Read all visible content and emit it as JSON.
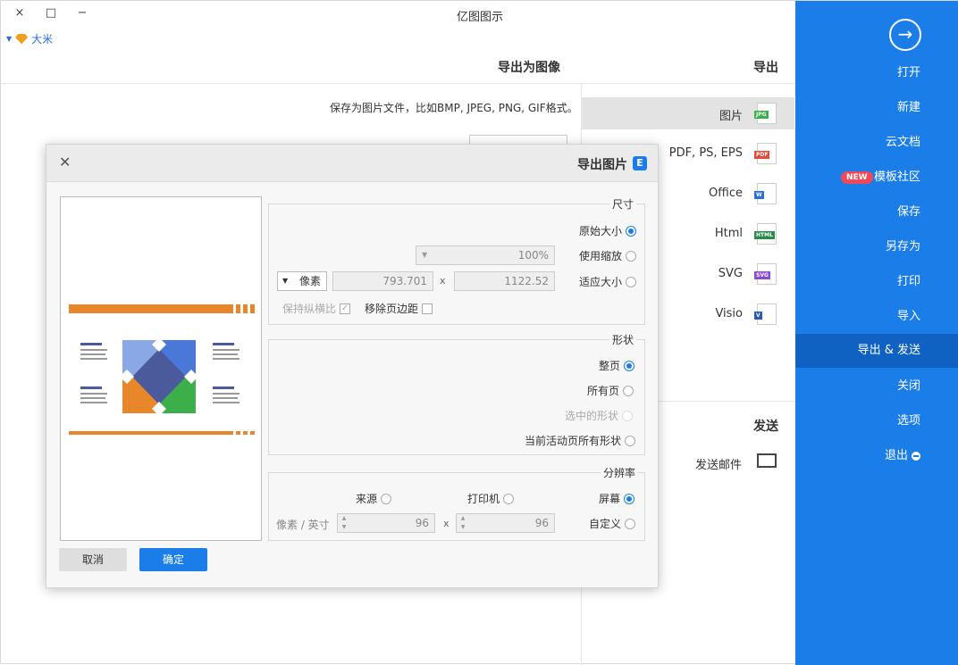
{
  "window": {
    "title": "亿图图示",
    "controls": {
      "close": "×",
      "maximize": "□",
      "minimize": "−"
    },
    "user": "大米"
  },
  "sidebar": {
    "back_icon": "arrow-right-circle-icon",
    "items": [
      {
        "label": "打开",
        "name": "open"
      },
      {
        "label": "新建",
        "name": "new"
      },
      {
        "label": "云文档",
        "name": "cloud-docs"
      },
      {
        "label": "模板社区",
        "name": "template-community",
        "badge": "NEW"
      },
      {
        "label": "保存",
        "name": "save"
      },
      {
        "label": "另存为",
        "name": "save-as"
      },
      {
        "label": "打印",
        "name": "print"
      },
      {
        "label": "导入",
        "name": "import"
      },
      {
        "label": "导出 & 发送",
        "name": "export-send",
        "active": true
      },
      {
        "label": "关闭",
        "name": "close"
      },
      {
        "label": "选项",
        "name": "options"
      },
      {
        "label": "退出",
        "name": "exit"
      }
    ],
    "accent": "#1b7ee8"
  },
  "export_panel": {
    "heading": "导出",
    "items": [
      {
        "label": "图片",
        "icon_tag": "JPG",
        "tag_color": "#3cae4a",
        "active": true
      },
      {
        "label": "PDF, PS, EPS",
        "icon_tag": "PDF",
        "tag_color": "#e84a3a"
      },
      {
        "label": "Office",
        "icon_tag": "W",
        "tag_color": "#2a6fd6"
      },
      {
        "label": "Html",
        "icon_tag": "HTML",
        "tag_color": "#2a8a4a"
      },
      {
        "label": "SVG",
        "icon_tag": "SVG",
        "tag_color": "#8a4ad6"
      },
      {
        "label": "Visio",
        "icon_tag": "V",
        "tag_color": "#2a5ab8"
      }
    ],
    "send_heading": "发送",
    "send_item": "发送邮件"
  },
  "detail": {
    "heading": "导出为图像",
    "description": "保存为图片文件，比如BMP, JPEG, PNG, GIF格式。"
  },
  "dialog": {
    "title": "导出图片",
    "size": {
      "legend": "尺寸",
      "options": [
        "原始大小",
        "使用缩放",
        "适应大小"
      ],
      "selected": "原始大小",
      "scale_value": "100%",
      "width": "1122.52",
      "height": "793.701",
      "unit": "像素",
      "remove_margin": "移除页边距",
      "keep_ratio": "保持纵横比"
    },
    "shape": {
      "legend": "形状",
      "options": [
        "整页",
        "所有页",
        "选中的形状",
        "当前活动页所有形状"
      ],
      "selected": "整页"
    },
    "resolution": {
      "legend": "分辨率",
      "options": [
        "屏幕",
        "打印机",
        "来源",
        "自定义"
      ],
      "selected": "屏幕",
      "dpi_x": "96",
      "dpi_y": "96",
      "unit": "像素 / 英寸"
    },
    "ok": "确定",
    "cancel": "取消"
  }
}
